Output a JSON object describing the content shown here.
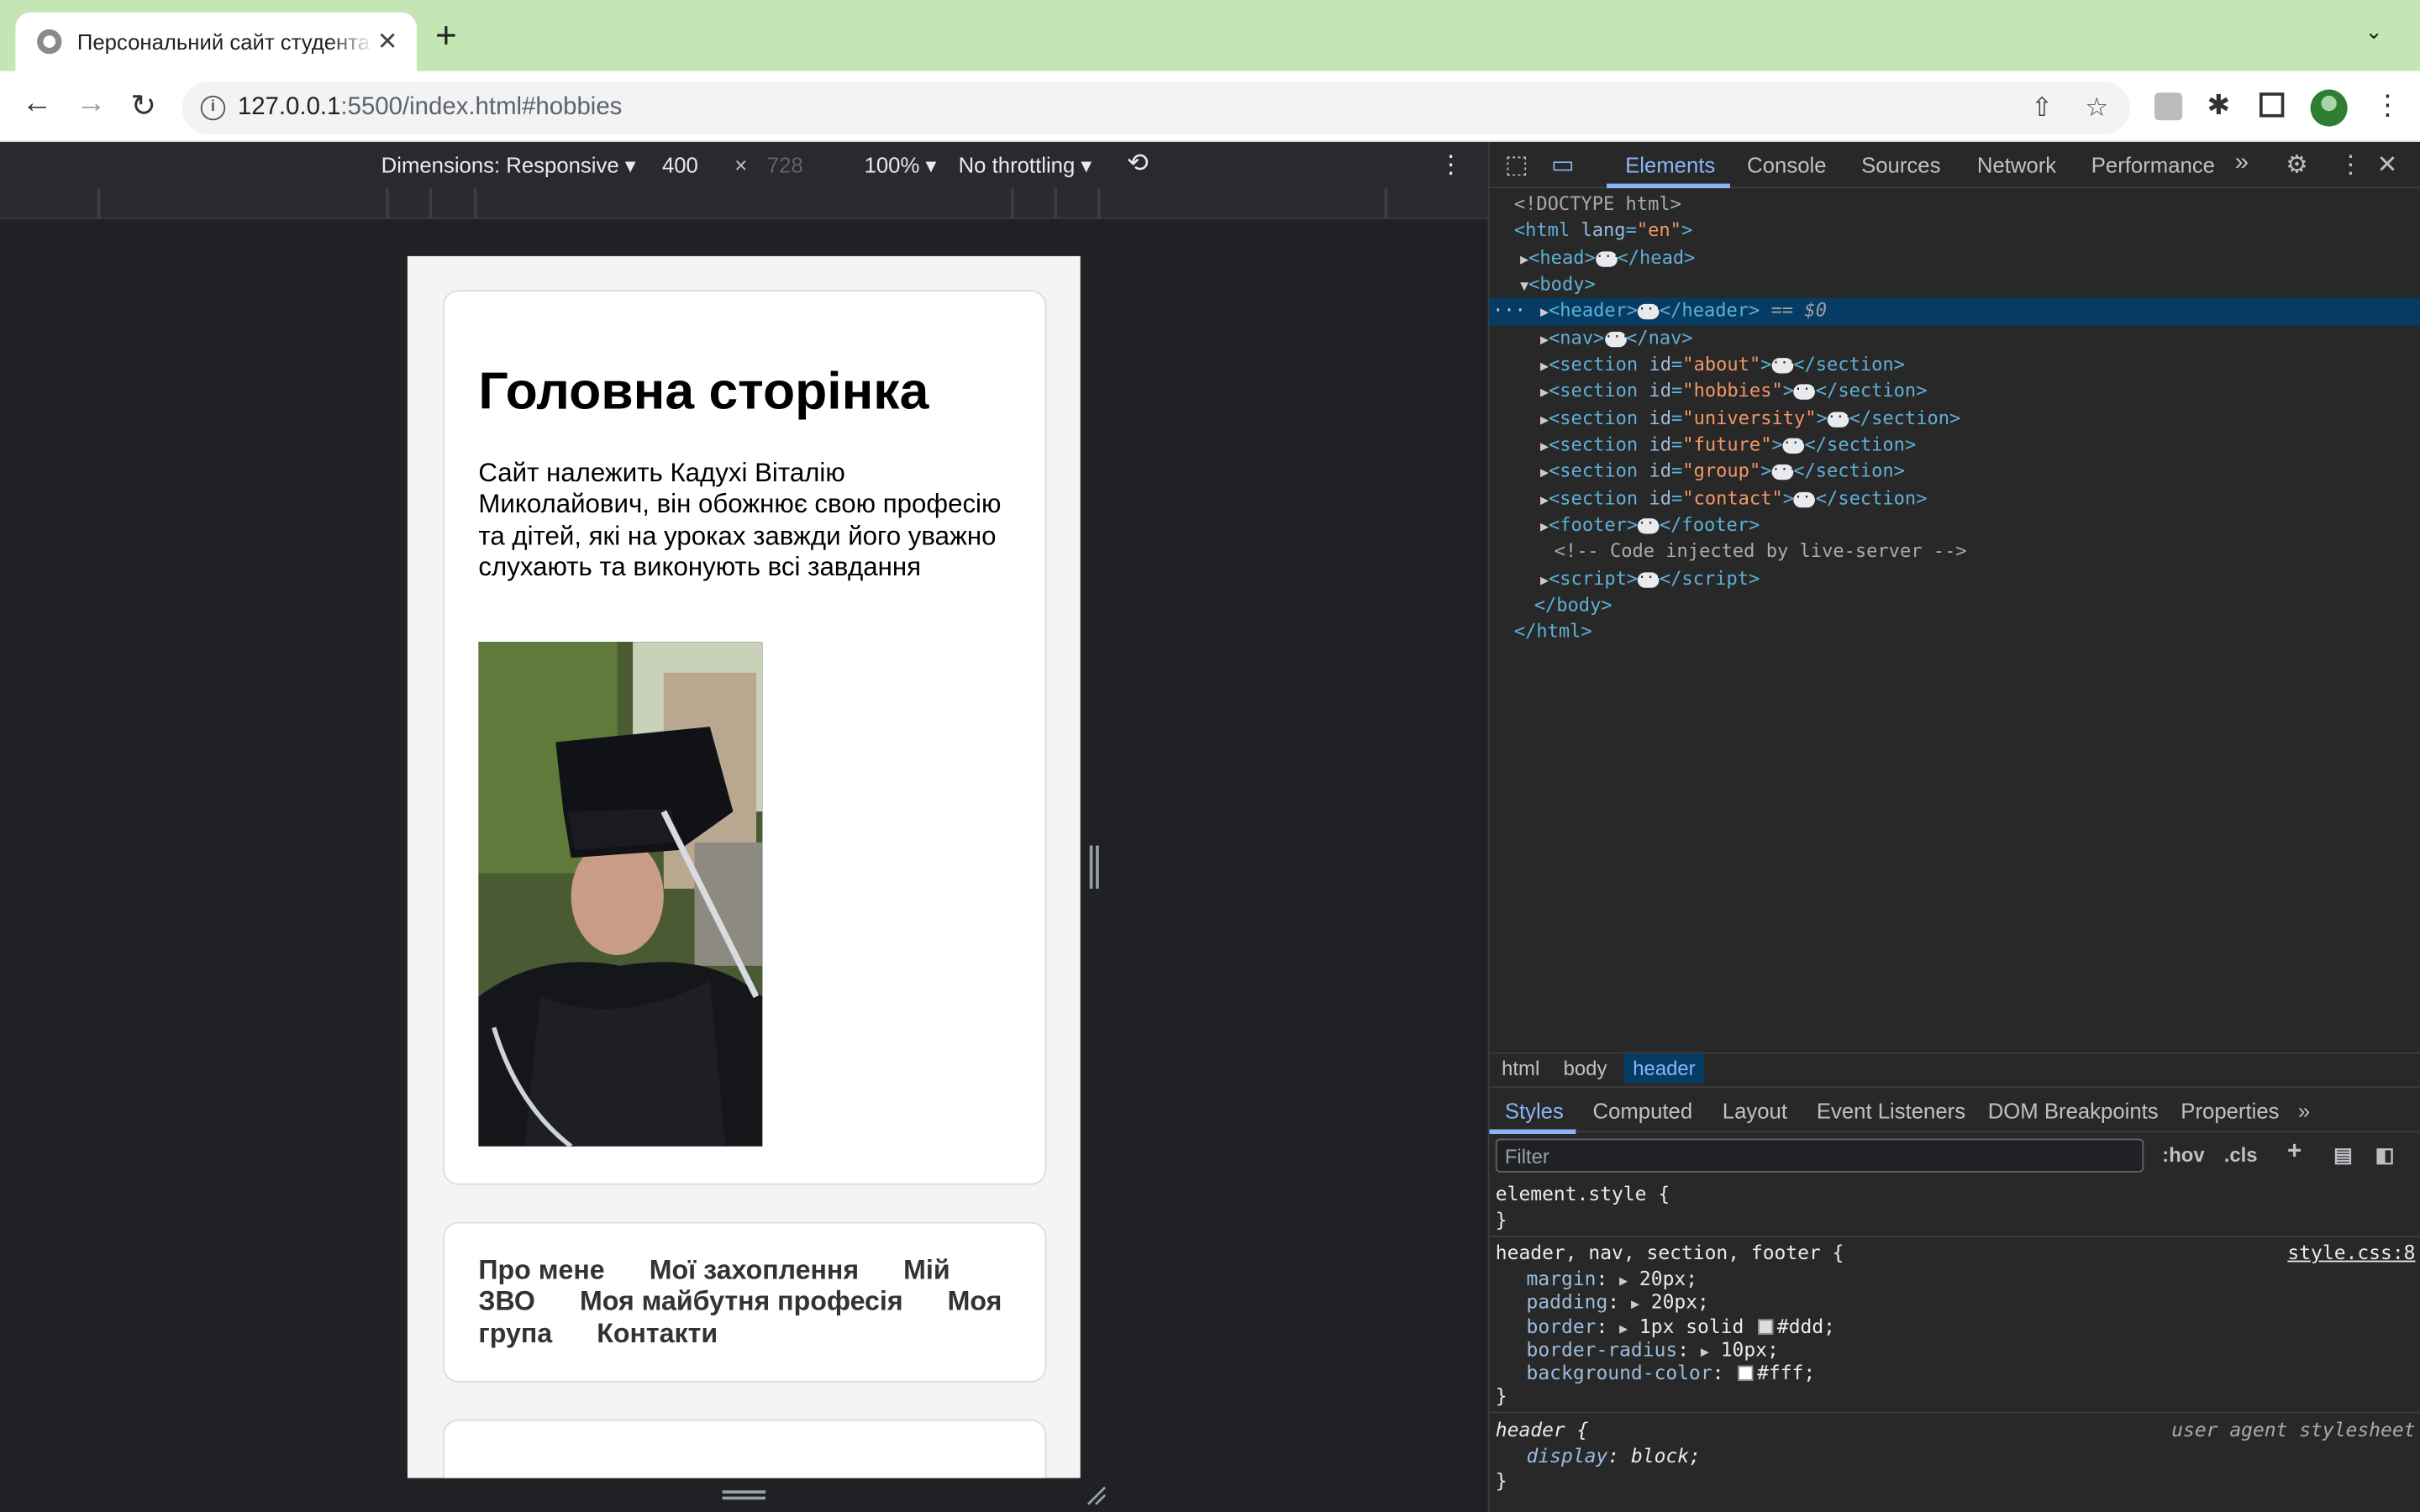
{
  "browser": {
    "tab_title": "Персональний сайт студента",
    "new_tab": "+",
    "url_host": "127.0.0.1",
    "url_rest": ":5500/index.html#hobbies"
  },
  "device_toolbar": {
    "dimensions": "Dimensions: Responsive ▾",
    "width": "400",
    "times": "×",
    "height": "728",
    "zoom": "100% ▾",
    "throttling": "No throttling ▾"
  },
  "page": {
    "heading": "Головна сторінка",
    "paragraph": "Сайт належить Кадухі Віталію Миколайович, він обожнює свою професію та дітей, які на уроках завжди його уважно слухають та виконують всі завдання",
    "nav": [
      "Про мене",
      "Мої захоплення",
      "Мій ЗВО",
      "Моя майбутня професія",
      "Моя група",
      "Контакти"
    ]
  },
  "devtools": {
    "tabs": [
      "Elements",
      "Console",
      "Sources",
      "Network",
      "Performance"
    ],
    "breadcrumbs": [
      "html",
      "body",
      "header"
    ],
    "styles_tabs": [
      "Styles",
      "Computed",
      "Layout",
      "Event Listeners",
      "DOM Breakpoints",
      "Properties"
    ],
    "filter_placeholder": "Filter",
    "hov": ":hov",
    "cls": ".cls",
    "dom": {
      "doctype": "<!DOCTYPE html>",
      "comment": "<!-- Code injected by live-server -->",
      "selected_marker": "== $0",
      "sections": [
        "about",
        "hobbies",
        "university",
        "future",
        "group",
        "contact"
      ]
    },
    "rules": {
      "element_style": "element.style {",
      "close": "}",
      "selector": "header, nav, section, footer {",
      "source": "style.css:8",
      "margin": "20px;",
      "padding": "20px;",
      "border": "1px solid",
      "border_color": "#ddd;",
      "radius": "10px;",
      "bg": "#fff;",
      "ua_selector": "header {",
      "ua_label": "user agent stylesheet",
      "display": "block;"
    }
  },
  "colors": {
    "tab_strip": "#c4e6b4",
    "devtools_bg": "#282828",
    "accent": "#8ab4f8"
  }
}
